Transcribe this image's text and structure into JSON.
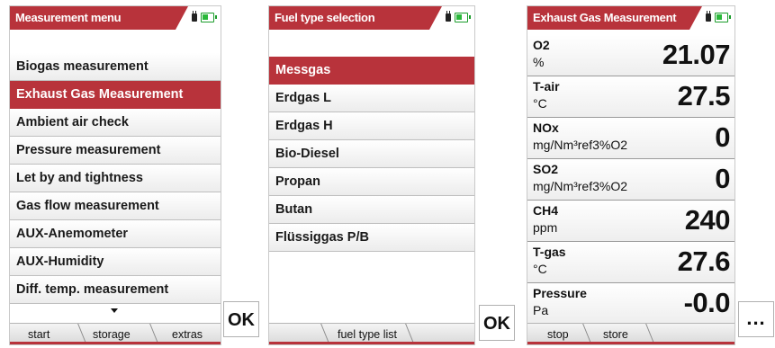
{
  "screens": {
    "measurement_menu": {
      "title": "Measurement menu",
      "items": [
        "Biogas measurement",
        "Exhaust Gas Measurement",
        "Ambient air check",
        "Pressure measurement",
        "Let by and tightness",
        "Gas flow measurement",
        "AUX-Anemometer",
        "AUX-Humidity",
        "Diff. temp. measurement"
      ],
      "selected_index": 1,
      "softkeys": {
        "left": "start",
        "middle": "storage",
        "right": "extras"
      }
    },
    "fuel_type_selection": {
      "title": "Fuel type selection",
      "items": [
        "Messgas",
        "Erdgas L",
        "Erdgas H",
        "Bio-Diesel",
        "Propan",
        "Butan",
        "Flüssiggas P/B"
      ],
      "selected_index": 0,
      "softkeys": {
        "middle": "fuel type list"
      }
    },
    "exhaust_gas_measurement": {
      "title": "Exhaust Gas Measurement",
      "rows": [
        {
          "name": "O2",
          "unit": "%",
          "value": "21.07"
        },
        {
          "name": "T-air",
          "unit": "°C",
          "value": "27.5"
        },
        {
          "name": "NOx",
          "unit": "mg/Nm³ref3%O2",
          "value": "0"
        },
        {
          "name": "SO2",
          "unit": "mg/Nm³ref3%O2",
          "value": "0"
        },
        {
          "name": "CH4",
          "unit": "ppm",
          "value": "240"
        },
        {
          "name": "T-gas",
          "unit": "°C",
          "value": "27.6"
        },
        {
          "name": "Pressure",
          "unit": "Pa",
          "value": "-0.0"
        }
      ],
      "softkeys": {
        "left": "stop",
        "middle": "store"
      }
    }
  },
  "buttons": {
    "ok1": "OK",
    "ok2": "OK",
    "more": "..."
  },
  "icons": {
    "power": "plug-icon",
    "battery": "battery-icon"
  },
  "colors": {
    "accent": "#b8333b",
    "battery": "#2ab83a"
  }
}
